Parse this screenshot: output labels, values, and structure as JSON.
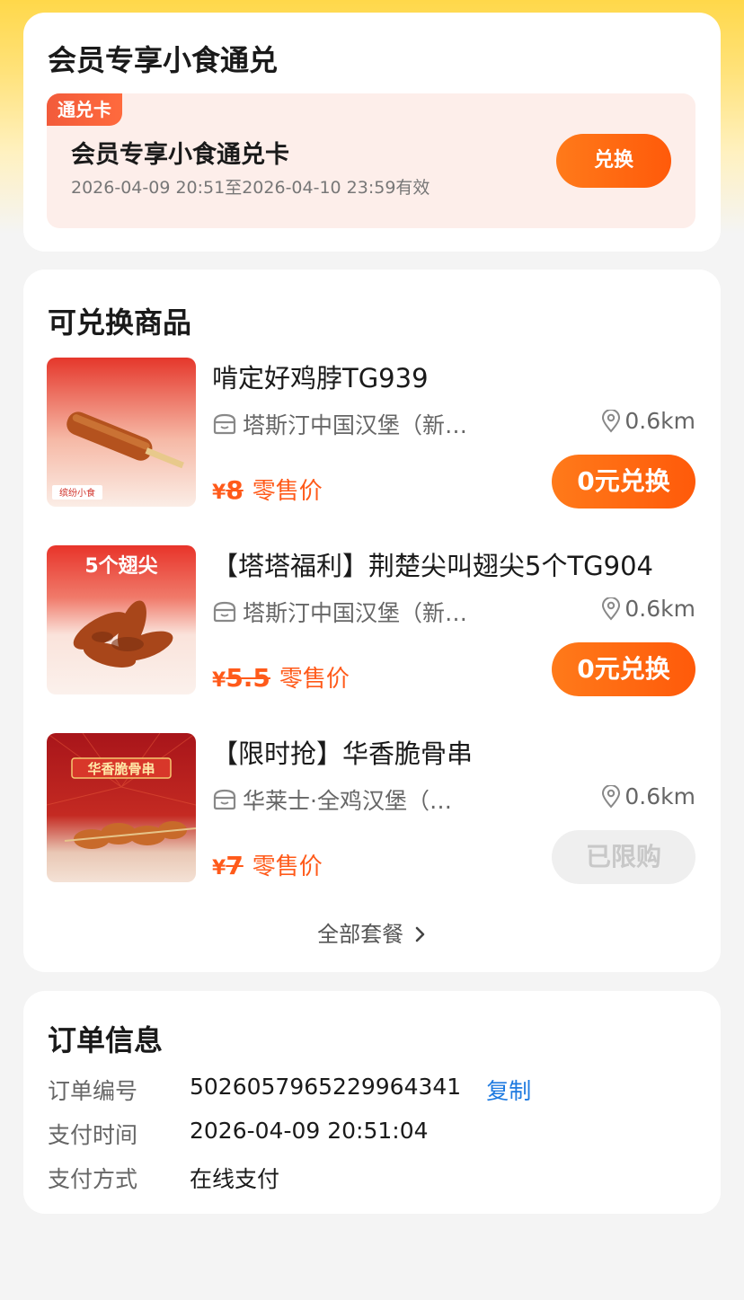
{
  "voucher_section": {
    "title": "会员专享小食通兑",
    "tag": "通兑卡",
    "name": "会员专享小食通兑卡",
    "validity": "2026-04-09 20:51至2026-04-10 23:59有效",
    "redeem_label": "兑换"
  },
  "products_section": {
    "title": "可兑换商品",
    "items": [
      {
        "name": "啃定好鸡脖TG939",
        "store": "塔斯汀中国汉堡（新…",
        "distance": "0.6km",
        "currency": "¥",
        "price": "8",
        "price_label": "零售价",
        "button": "0元兑换",
        "image_text": "缤纷小食"
      },
      {
        "name": "【塔塔福利】荆楚尖叫翅尖5个TG904",
        "store": "塔斯汀中国汉堡（新…",
        "distance": "0.6km",
        "currency": "¥",
        "price": "5.5",
        "price_label": "零售价",
        "button": "0元兑换",
        "image_text": "5个翅尖"
      },
      {
        "name": "【限时抢】华香脆骨串",
        "store": "华莱士·全鸡汉堡（…",
        "distance": "0.6km",
        "currency": "¥",
        "price": "7",
        "price_label": "零售价",
        "button": "已限购",
        "image_text": "华香脆骨串"
      }
    ],
    "more_label": "全部套餐"
  },
  "order_section": {
    "title": "订单信息",
    "rows": [
      {
        "label": "订单编号",
        "value": "5026057965229964341",
        "action": "复制"
      },
      {
        "label": "支付时间",
        "value": "2026-04-09 20:51:04"
      },
      {
        "label": "支付方式",
        "value": "在线支付"
      }
    ]
  },
  "colors": {
    "accent": "#FF5A0A",
    "link": "#1E7AE0",
    "header_yellow": "#FFD84A"
  }
}
